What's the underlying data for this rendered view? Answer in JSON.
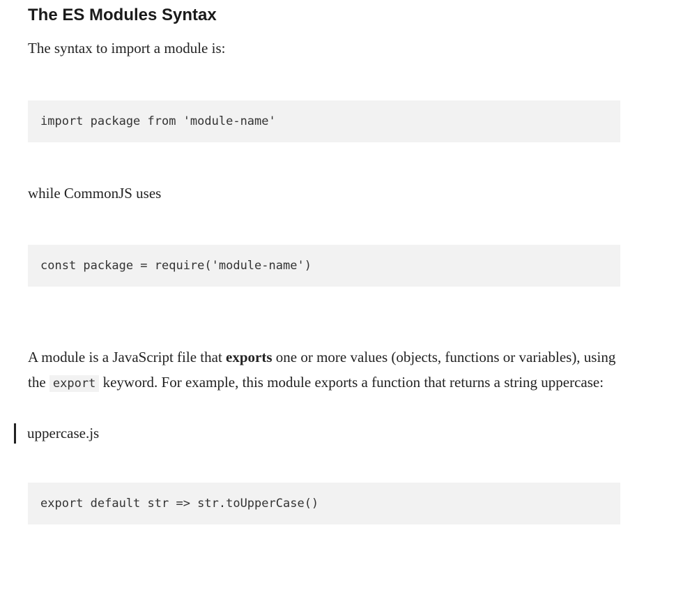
{
  "heading": "The ES Modules Syntax",
  "intro": "The syntax to import a module is:",
  "code1": "import package from 'module-name'",
  "transition": "while CommonJS uses",
  "code2": "const package = require('module-name')",
  "para": {
    "before_exports": "A module is a JavaScript file that ",
    "exports_word": "exports",
    "after_exports": " one or more values (objects, functions or variables), using the ",
    "inline_code": "export",
    "after_code": " keyword. For example, this module exports a function that returns a string uppercase:"
  },
  "filename": "uppercase.js",
  "code3": "export default str => str.toUpperCase()"
}
